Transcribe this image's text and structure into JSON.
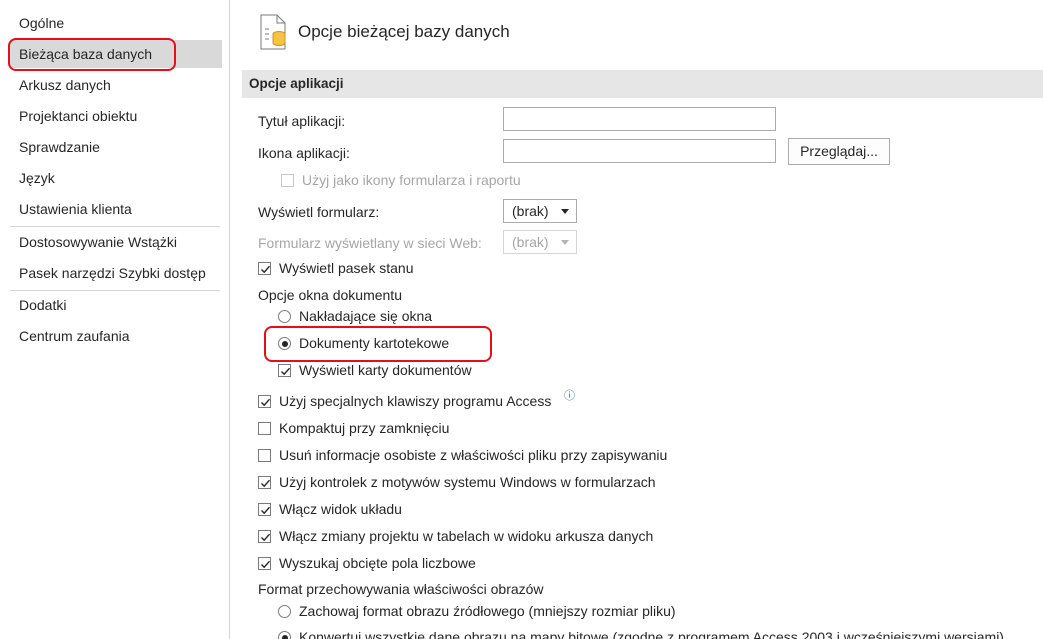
{
  "sidebar": {
    "items": [
      {
        "label": "Ogólne"
      },
      {
        "label": "Bieżąca baza danych"
      },
      {
        "label": "Arkusz danych"
      },
      {
        "label": "Projektanci obiektu"
      },
      {
        "label": "Sprawdzanie"
      },
      {
        "label": "Język"
      },
      {
        "label": "Ustawienia klienta"
      },
      {
        "label": "Dostosowywanie Wstążki"
      },
      {
        "label": "Pasek narzędzi Szybki dostęp"
      },
      {
        "label": "Dodatki"
      },
      {
        "label": "Centrum zaufania"
      }
    ],
    "selected": "Bieżąca baza danych"
  },
  "header": {
    "title": "Opcje bieżącej bazy danych",
    "icon": "database-options-icon"
  },
  "section": {
    "title": "Opcje aplikacji"
  },
  "fields": {
    "app_title_label": "Tytuł aplikacji:",
    "app_title_value": "",
    "app_icon_label": "Ikona aplikacji:",
    "app_icon_value": "",
    "browse_button": "Przeglądaj...",
    "use_as_icon_label": "Użyj jako ikony formularza i raportu",
    "display_form_label": "Wyświetl formularz:",
    "display_form_value": "(brak)",
    "web_form_label": "Formularz wyświetlany w sieci Web:",
    "web_form_value": "(brak)",
    "show_status_bar": "Wyświetl pasek stanu",
    "doc_window_options": "Opcje okna dokumentu",
    "overlapping_windows": "Nakładające się okna",
    "tabbed_documents": "Dokumenty kartotekowe",
    "show_doc_tabs": "Wyświetl karty dokumentów",
    "access_special_keys": "Użyj specjalnych klawiszy programu Access",
    "compact_on_close": "Kompaktuj przy zamknięciu",
    "remove_personal_info": "Usuń informacje osobiste z właściwości pliku przy zapisywaniu",
    "windows_themed_controls": "Użyj kontrolek z motywów systemu Windows w formularzach",
    "enable_layout_view": "Włącz widok układu",
    "enable_design_changes": "Włącz zmiany projektu w tabelach w widoku arkusza danych",
    "check_truncated_fields": "Wyszukaj obcięte pola liczbowe",
    "picture_format_label": "Format przechowywania właściwości obrazów",
    "preserve_source_format": "Zachowaj format obrazu źródłowego (mniejszy rozmiar pliku)",
    "convert_to_bitmaps": "Konwertuj wszystkie dane obrazu na mapy bitowe (zgodne z programem Access 2003 i wcześniejszymi wersjami)"
  },
  "states": {
    "show_status_bar": true,
    "tabbed_documents_selected": true,
    "show_doc_tabs": true,
    "access_special_keys": true,
    "compact_on_close": false,
    "remove_personal_info": false,
    "windows_themed_controls": true,
    "enable_layout_view": true,
    "enable_design_changes": true,
    "check_truncated_fields": true,
    "use_as_icon": false,
    "convert_to_bitmaps_selected": true
  },
  "colors": {
    "highlight_box": "#e3101b",
    "selected_bg": "#d9d9d9",
    "section_bg": "#e6e6e6"
  }
}
